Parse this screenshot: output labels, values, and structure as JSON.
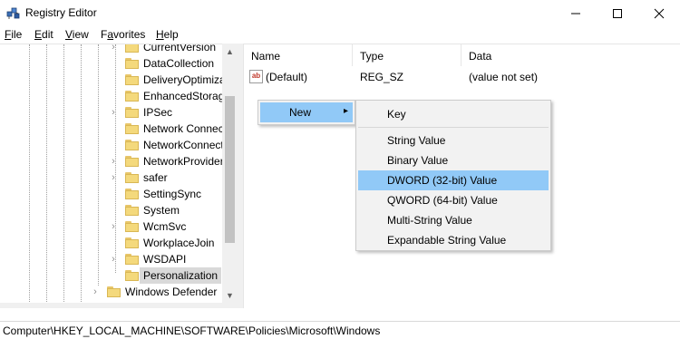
{
  "window": {
    "title": "Registry Editor",
    "icon": "registry-editor-icon"
  },
  "menu": {
    "file_rest": "ile",
    "file_key": "F",
    "edit_rest": "dit",
    "edit_key": "E",
    "view_rest": "iew",
    "view_key": "V",
    "favorites_pre": "F",
    "favorites_key": "a",
    "favorites_rest": "vorites",
    "help_rest": "elp",
    "help_key": "H"
  },
  "tree": {
    "items": [
      {
        "label": "CurrentVersion",
        "expandable": true
      },
      {
        "label": "DataCollection",
        "expandable": false
      },
      {
        "label": "DeliveryOptimization",
        "expandable": false
      },
      {
        "label": "EnhancedStorageDevices",
        "expandable": false
      },
      {
        "label": "IPSec",
        "expandable": true
      },
      {
        "label": "Network Connections",
        "expandable": false
      },
      {
        "label": "NetworkConnectivityStatusIndicator",
        "expandable": false
      },
      {
        "label": "NetworkProvider",
        "expandable": true
      },
      {
        "label": "safer",
        "expandable": true
      },
      {
        "label": "SettingSync",
        "expandable": false
      },
      {
        "label": "System",
        "expandable": false
      },
      {
        "label": "WcmSvc",
        "expandable": true
      },
      {
        "label": "WorkplaceJoin",
        "expandable": false
      },
      {
        "label": "WSDAPI",
        "expandable": true
      },
      {
        "label": "Personalization",
        "expandable": false,
        "selected": true
      },
      {
        "label": "Windows Defender",
        "expandable": true
      }
    ]
  },
  "list": {
    "columns": {
      "name": "Name",
      "type": "Type",
      "data": "Data"
    },
    "rows": [
      {
        "name": "(Default)",
        "type": "REG_SZ",
        "data": "(value not set)",
        "icon": "string-value-icon"
      }
    ]
  },
  "context_menu": {
    "new_label": "New",
    "arrow": "›"
  },
  "submenu": {
    "items": [
      {
        "label": "Key"
      },
      {
        "label": "String Value"
      },
      {
        "label": "Binary Value"
      },
      {
        "label": "DWORD (32-bit) Value",
        "highlighted": true
      },
      {
        "label": "QWORD (64-bit) Value"
      },
      {
        "label": "Multi-String Value"
      },
      {
        "label": "Expandable String Value"
      }
    ]
  },
  "statusbar": {
    "path": "Computer\\HKEY_LOCAL_MACHINE\\SOFTWARE\\Policies\\Microsoft\\Windows"
  },
  "colors": {
    "highlight": "#91c9f7",
    "menu_bg": "#f2f2f2",
    "folder": "#f4d97c"
  }
}
